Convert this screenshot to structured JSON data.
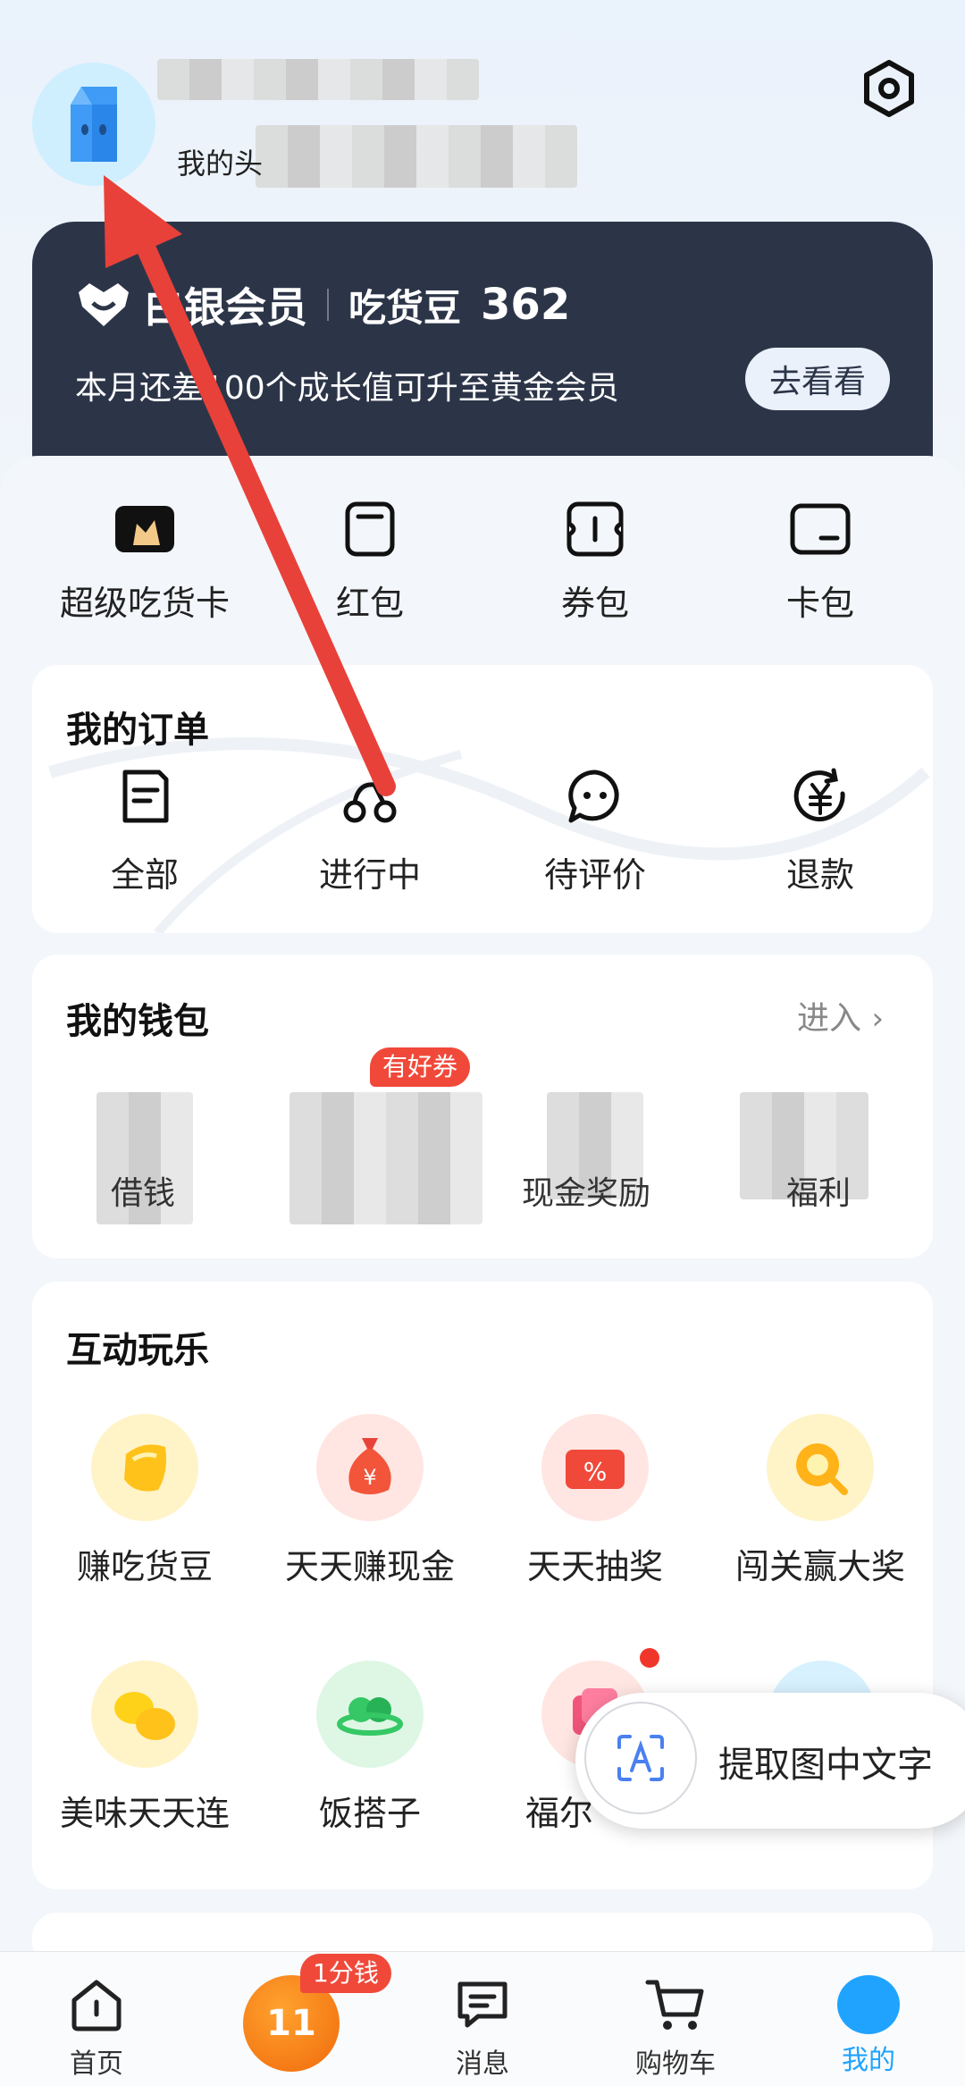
{
  "profile": {
    "nickname_prefix": "我的头"
  },
  "vip": {
    "level": "白银会员",
    "beans_label": "吃货豆",
    "beans_count": "362",
    "desc": "本月还差100个成长值可升至黄金会员",
    "cta": "去看看"
  },
  "quick": [
    "超级吃货卡",
    "红包",
    "券包",
    "卡包"
  ],
  "orders": {
    "title": "我的订单",
    "items": [
      "全部",
      "进行中",
      "待评价",
      "退款"
    ]
  },
  "wallet": {
    "title": "我的钱包",
    "enter": "进入",
    "badge": "有好券",
    "items": [
      "借钱",
      "",
      "现金奖励",
      "福利"
    ]
  },
  "fun": {
    "title": "互动玩乐",
    "items": [
      "赚吃货豆",
      "天天赚现金",
      "天天抽奖",
      "闯关赢大奖",
      "美味天天连",
      "饭搭子",
      "福尔"
    ]
  },
  "float_action": "提取图中文字",
  "tabs": [
    {
      "label": "首页"
    },
    {
      "label": ""
    },
    {
      "label": "消息"
    },
    {
      "label": "购物车"
    },
    {
      "label": "我的"
    }
  ],
  "tab_badge": "1分钱",
  "colors": {
    "accent": "#1fa3ff",
    "vip_bg": "#2c3548",
    "arrow": "#e8413a"
  }
}
